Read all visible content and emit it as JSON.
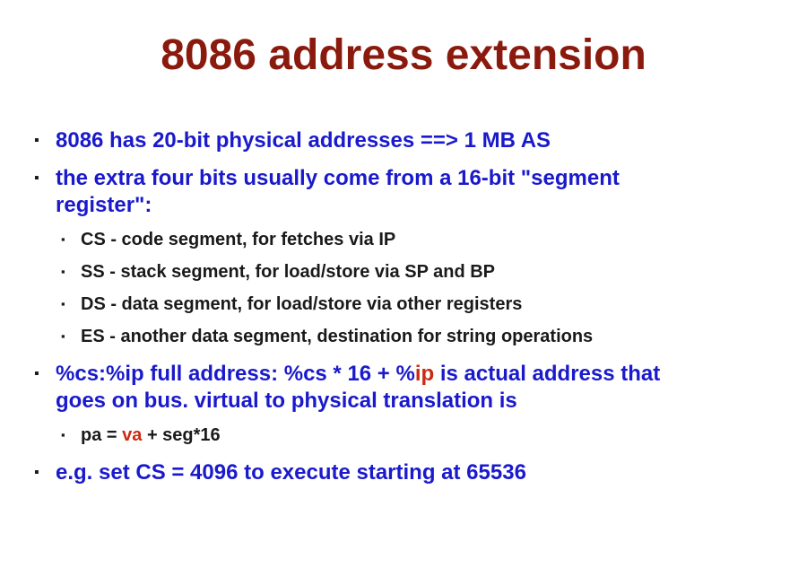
{
  "slide": {
    "title": "8086 address extension",
    "bullet_glyph": "▪",
    "items": [
      {
        "text": "8086 has 20-bit physical addresses ==> 1 MB AS"
      },
      {
        "line1": "the extra four bits usually come from a 16-bit \"segment",
        "line2": "register\":"
      },
      {
        "text": "CS - code segment, for fetches via IP"
      },
      {
        "text": "SS - stack segment, for load/store via SP and BP"
      },
      {
        "text": "DS - data segment, for load/store via other registers"
      },
      {
        "text": "ES - another data segment, destination for string operations"
      },
      {
        "line1_a": "%cs:%ip  full address:  %cs * 16 + %",
        "line1_red": "ip",
        "line1_b": "  is actual address that",
        "line2": "goes on bus. virtual to physical translation is"
      },
      {
        "a": "pa = ",
        "red": "va",
        "b": " + seg*16"
      },
      {
        "text": "e.g. set CS = 4096 to execute starting at 65536"
      }
    ],
    "colors": {
      "title": "#8b1a0e",
      "level1": "#1a1acc",
      "level2": "#1a1a1a",
      "highlight": "#cc2a10"
    }
  }
}
